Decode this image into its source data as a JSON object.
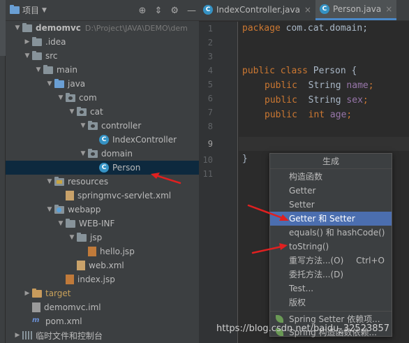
{
  "project_panel": {
    "title": "项目",
    "tree": [
      {
        "label": "demomvc",
        "path": "D:\\Project\\JAVA\\DEMO\\dem",
        "kind": "module",
        "expanded": true
      },
      {
        "label": ".idea",
        "kind": "folder",
        "expanded": false
      },
      {
        "label": "src",
        "kind": "folder",
        "expanded": true
      },
      {
        "label": "main",
        "kind": "folder",
        "expanded": true
      },
      {
        "label": "java",
        "kind": "source-root",
        "expanded": true
      },
      {
        "label": "com",
        "kind": "package",
        "expanded": true
      },
      {
        "label": "cat",
        "kind": "package",
        "expanded": true
      },
      {
        "label": "controller",
        "kind": "package",
        "expanded": true
      },
      {
        "label": "IndexController",
        "kind": "class"
      },
      {
        "label": "domain",
        "kind": "package",
        "expanded": true
      },
      {
        "label": "Person",
        "kind": "class",
        "selected": true
      },
      {
        "label": "resources",
        "kind": "resources-root",
        "expanded": true
      },
      {
        "label": "springmvc-servlet.xml",
        "kind": "xml"
      },
      {
        "label": "webapp",
        "kind": "web-root",
        "expanded": true
      },
      {
        "label": "WEB-INF",
        "kind": "folder",
        "expanded": true
      },
      {
        "label": "jsp",
        "kind": "folder",
        "expanded": true
      },
      {
        "label": "hello.jsp",
        "kind": "jsp"
      },
      {
        "label": "web.xml",
        "kind": "xml"
      },
      {
        "label": "index.jsp",
        "kind": "jsp"
      },
      {
        "label": "target",
        "kind": "excluded-folder",
        "expanded": false
      },
      {
        "label": "demomvc.iml",
        "kind": "iml"
      },
      {
        "label": "pom.xml",
        "kind": "pom"
      },
      {
        "label": "临时文件和控制台",
        "kind": "scratches",
        "expanded": false
      }
    ]
  },
  "editor": {
    "tabs": [
      {
        "label": "IndexController.java",
        "active": false
      },
      {
        "label": "Person.java",
        "active": true
      }
    ],
    "line_numbers": [
      "1",
      "2",
      "3",
      "4",
      "5",
      "6",
      "7",
      "8",
      "9",
      "10",
      "11"
    ],
    "code": {
      "l1": {
        "kw": "package",
        "rest": " com.cat.domain;"
      },
      "l4": {
        "kw": "public class",
        "rest": " Person {"
      },
      "l5": {
        "kw": "public",
        "type": "  String",
        "field": " name",
        "end": ";"
      },
      "l6": {
        "kw": "public",
        "type": "  String",
        "field": " sex",
        "end": ";"
      },
      "l7": {
        "kw": "public",
        "type": "  int",
        "field": " age",
        "end": ";"
      },
      "l10": "}"
    }
  },
  "generate_popup": {
    "title": "生成",
    "items": [
      {
        "label": "构造函数"
      },
      {
        "label": "Getter"
      },
      {
        "label": "Setter"
      },
      {
        "label": "Getter 和 Setter",
        "active": true
      },
      {
        "label": "equals() 和 hashCode()"
      },
      {
        "label": "toString()"
      },
      {
        "label": "重写方法...(O)",
        "shortcut": "Ctrl+O"
      },
      {
        "label": "委托方法...(D)"
      },
      {
        "label": "Test..."
      },
      {
        "label": "版权"
      },
      {
        "label": "Spring Setter 依赖项..."
      },
      {
        "label": "Spring 构造函数依赖..."
      }
    ]
  },
  "watermark": "https://blog.csdn.net/baidu_32523857",
  "colors": {
    "selection": "#0d293e",
    "popup_active": "#4b6eaf",
    "annotation_arrow": "#e02020"
  }
}
